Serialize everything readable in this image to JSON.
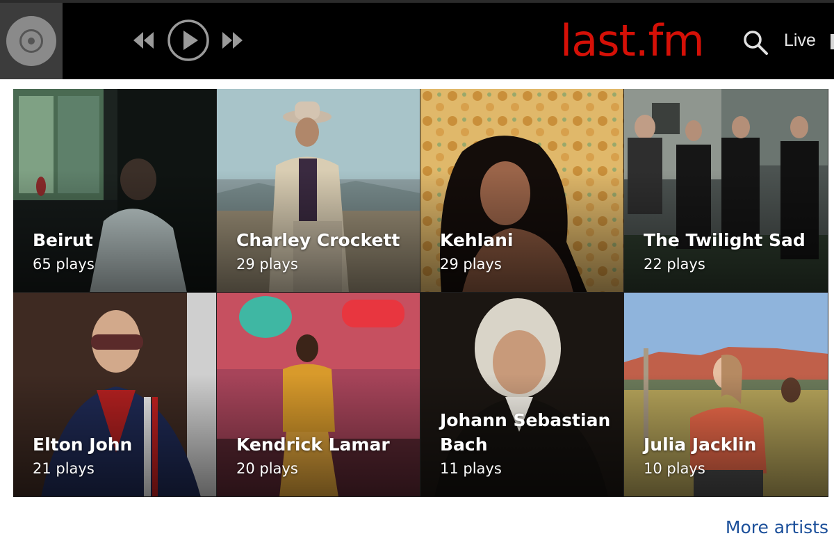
{
  "header": {
    "logo_text": "last.fm",
    "logo_color": "#d51007",
    "nav": [
      {
        "label": "Live"
      }
    ],
    "icons": {
      "scrobble": "disc-icon",
      "previous": "rewind-icon",
      "play": "play-icon",
      "next": "fast-forward-icon",
      "search": "search-icon"
    }
  },
  "artists": [
    {
      "name": "Beirut",
      "plays": "65 plays"
    },
    {
      "name": "Charley Crockett",
      "plays": "29 plays"
    },
    {
      "name": "Kehlani",
      "plays": "29 plays"
    },
    {
      "name": "The Twilight Sad",
      "plays": "22 plays"
    },
    {
      "name": "Elton John",
      "plays": "21 plays"
    },
    {
      "name": "Kendrick Lamar",
      "plays": "20 plays"
    },
    {
      "name": "Johann Sebastian Bach",
      "plays": "11 plays"
    },
    {
      "name": "Julia Jacklin",
      "plays": "10 plays"
    }
  ],
  "more_link": "More artists",
  "colors": {
    "topbar": "#000000",
    "accent_red": "#d51007",
    "link_blue": "#1b4f9a"
  }
}
